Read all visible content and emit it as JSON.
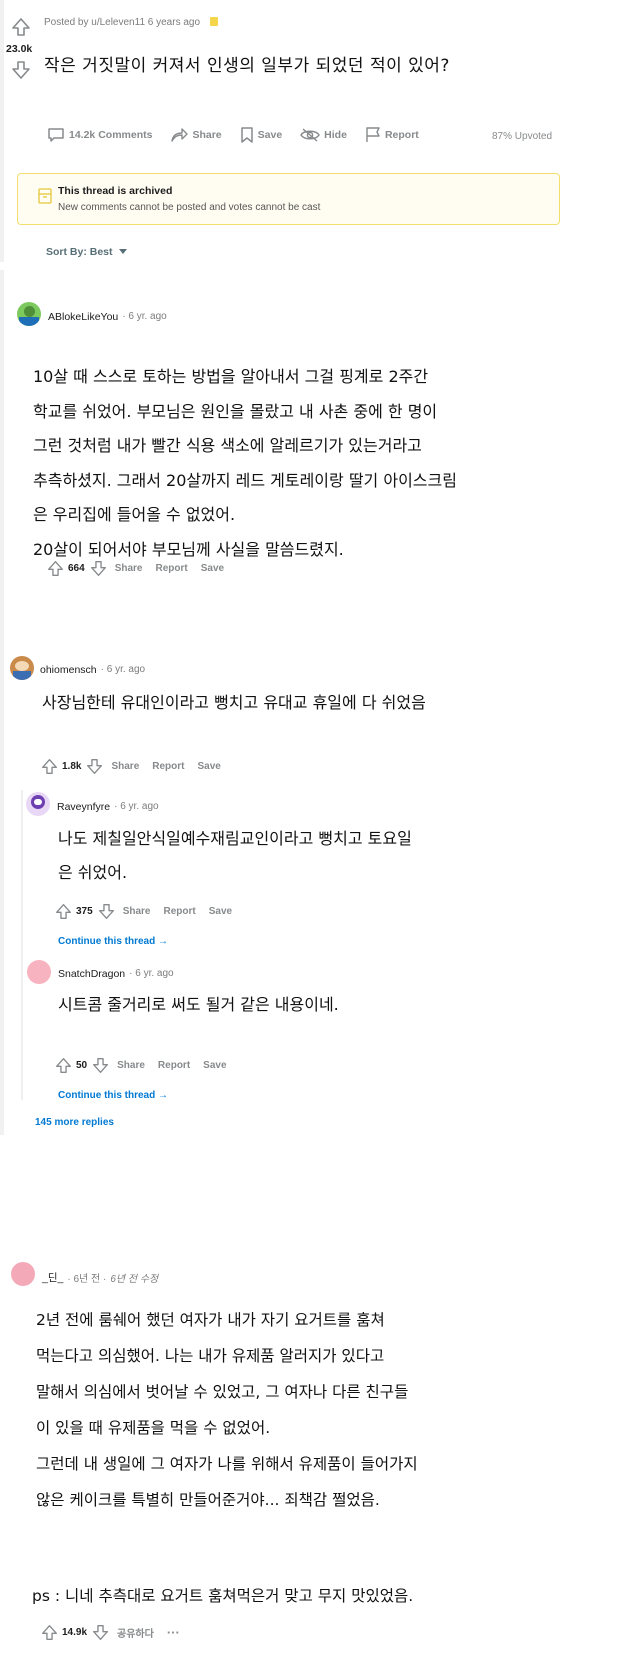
{
  "post": {
    "posted_by": "Posted by u/Leleven11 6 years ago",
    "score": "23.0k",
    "title": "작은 거짓말이 커져서 인생의 일부가 되었던 적이 있어?",
    "actions": {
      "comments": "14.2k Comments",
      "share": "Share",
      "save": "Save",
      "hide": "Hide",
      "report": "Report",
      "upvoted": "87% Upvoted"
    },
    "archived": {
      "title": "This thread is archived",
      "message": "New comments cannot be posted and votes cannot be cast"
    },
    "sort": "Sort By: Best"
  },
  "comments": [
    {
      "user": "ABlokeLikeYou",
      "age": "· 6 yr. ago",
      "lines": [
        "10살 때 스스로 토하는 방법을 알아내서 그걸 핑계로 2주간",
        "학교를 쉬었어. 부모님은 원인을 몰랐고 내 사촌 중에 한 명이",
        "그런 것처럼 내가 빨간 식용 색소에 알레르기가 있는거라고",
        "추측하셨지. 그래서 20살까지 레드 게토레이랑 딸기 아이스크림",
        "은 우리집에 들어올 수 없었어.",
        "20살이 되어서야 부모님께 사실을 말씀드렸지."
      ],
      "votes": "664",
      "share": "Share",
      "report": "Report",
      "save": "Save"
    },
    {
      "user": "ohiomensch",
      "age": "· 6 yr. ago",
      "lines": [
        "사장님한테 유대인이라고 뻥치고 유대교 휴일에 다 쉬었음"
      ],
      "votes": "1.8k",
      "share": "Share",
      "report": "Report",
      "save": "Save"
    },
    {
      "user": "Raveynfyre",
      "age": "· 6 yr. ago",
      "lines": [
        "나도 제칠일안식일예수재림교인이라고 뻥치고 토요일",
        "은 쉬었어."
      ],
      "votes": "375",
      "share": "Share",
      "report": "Report",
      "save": "Save",
      "continue": "Continue this thread →"
    },
    {
      "user": "SnatchDragon",
      "age": "· 6 yr. ago",
      "lines": [
        "시트콤 줄거리로 써도 될거 같은 내용이네."
      ],
      "votes": "50",
      "share": "Share",
      "report": "Report",
      "save": "Save",
      "continue": "Continue this thread →"
    },
    {
      "user": "_딘_",
      "age": "· 6년 전 ·",
      "edited": "6년 전 수정",
      "lines": [
        "2년 전에 룸쉐어 했던 여자가 내가 자기 요거트를 훔쳐",
        "먹는다고 의심했어. 나는 내가 유제품 알러지가 있다고",
        "말해서 의심에서 벗어날 수 있었고, 그 여자나 다른 친구들",
        "이 있을 때 유제품을 먹을 수 없었어.",
        "그런데 내 생일에 그 여자가 나를 위해서 유제품이 들어가지",
        "않은 케이크를 특별히 만들어준거야... 죄책감 쩔었음."
      ],
      "ps": "ps : 니네 추측대로 요거트 훔쳐먹은거 맞고 무지 맛있었음.",
      "votes": "14.9k",
      "share": "공유하다",
      "more": "···"
    }
  ],
  "more_replies": "145 more replies",
  "colors": {
    "archived_border": "#f2df6e",
    "archived_bg": "#fffdf2",
    "link": "#0079d3",
    "muted": "#878a8c"
  }
}
